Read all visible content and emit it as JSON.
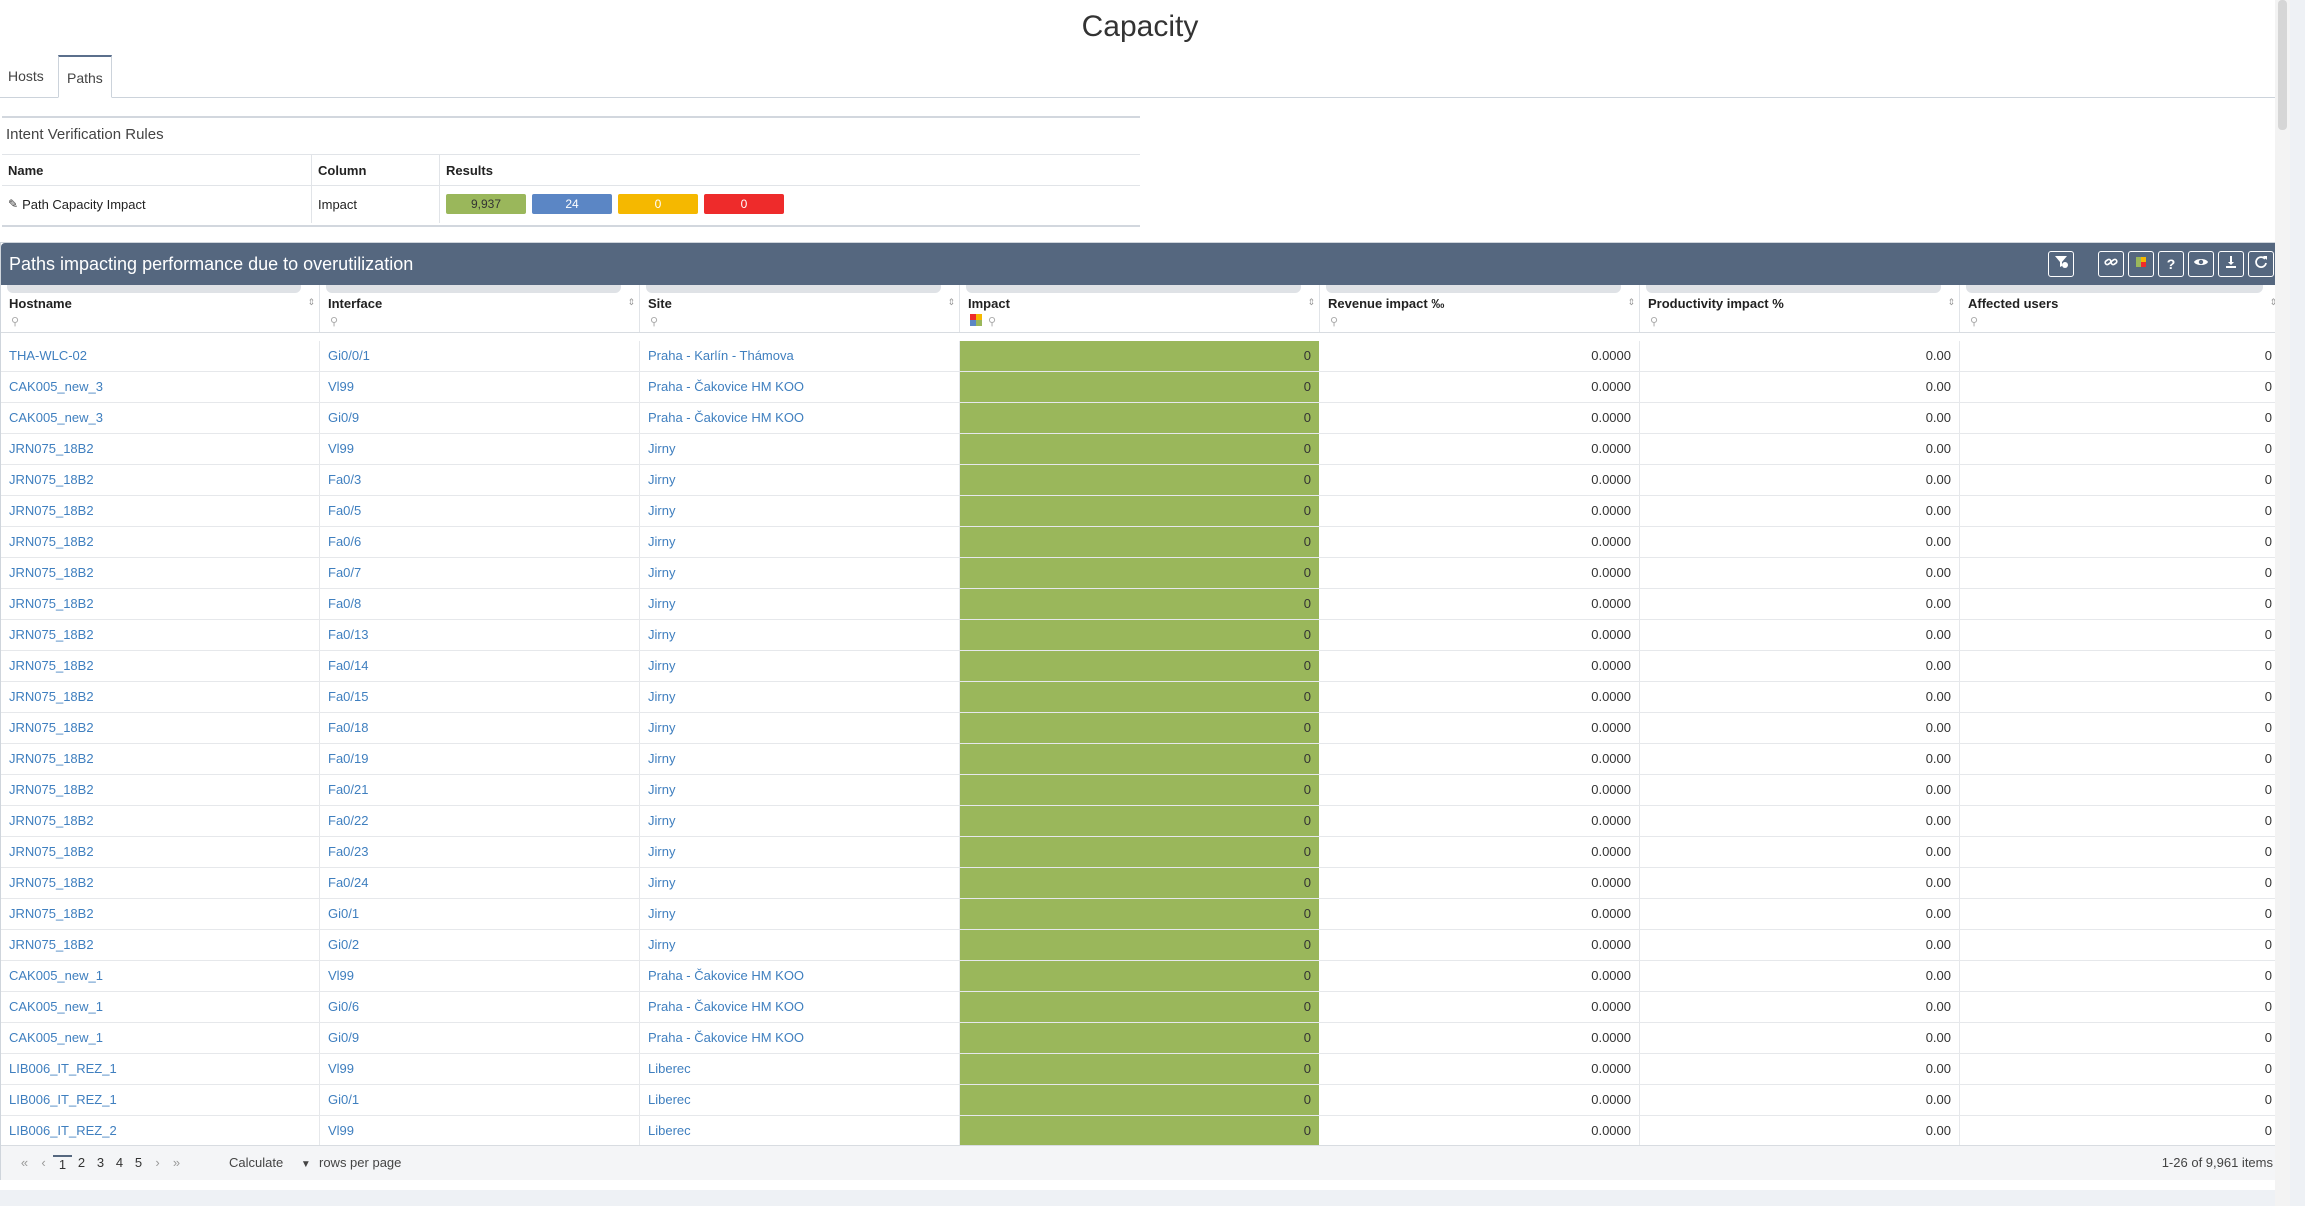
{
  "page_title": "Capacity",
  "tabs": [
    {
      "label": "Hosts",
      "active": false
    },
    {
      "label": "Paths",
      "active": true
    }
  ],
  "ivr": {
    "title": "Intent Verification Rules",
    "headers": {
      "name": "Name",
      "column": "Column",
      "results": "Results"
    },
    "row": {
      "name": "Path Capacity Impact",
      "column": "Impact",
      "results": [
        {
          "value": "9,937",
          "color": "#9ab75b",
          "text_color": "#333333"
        },
        {
          "value": "24",
          "color": "#5b86c5",
          "text_color": "#ffffff"
        },
        {
          "value": "0",
          "color": "#f5b800",
          "text_color": "#ffffff"
        },
        {
          "value": "0",
          "color": "#ee2b2b",
          "text_color": "#ffffff"
        }
      ]
    }
  },
  "grid": {
    "title": "Paths impacting performance due to overutilization",
    "toolbar_icons": [
      "filter-clear-icon",
      "link-icon",
      "color-legend-icon",
      "help-icon",
      "eye-icon",
      "download-icon",
      "refresh-icon"
    ],
    "columns": [
      "Hostname",
      "Interface",
      "Site",
      "Impact",
      "Revenue impact ‰",
      "Productivity impact %",
      "Affected users"
    ],
    "rows": [
      [
        "THA-WLC-02",
        "Gi0/0/1",
        "Praha - Karlín - Thámova",
        "0",
        "0.0000",
        "0.00",
        "0"
      ],
      [
        "CAK005_new_3",
        "Vl99",
        "Praha - Čakovice HM KOO",
        "0",
        "0.0000",
        "0.00",
        "0"
      ],
      [
        "CAK005_new_3",
        "Gi0/9",
        "Praha - Čakovice HM KOO",
        "0",
        "0.0000",
        "0.00",
        "0"
      ],
      [
        "JRN075_18B2",
        "Vl99",
        "Jirny",
        "0",
        "0.0000",
        "0.00",
        "0"
      ],
      [
        "JRN075_18B2",
        "Fa0/3",
        "Jirny",
        "0",
        "0.0000",
        "0.00",
        "0"
      ],
      [
        "JRN075_18B2",
        "Fa0/5",
        "Jirny",
        "0",
        "0.0000",
        "0.00",
        "0"
      ],
      [
        "JRN075_18B2",
        "Fa0/6",
        "Jirny",
        "0",
        "0.0000",
        "0.00",
        "0"
      ],
      [
        "JRN075_18B2",
        "Fa0/7",
        "Jirny",
        "0",
        "0.0000",
        "0.00",
        "0"
      ],
      [
        "JRN075_18B2",
        "Fa0/8",
        "Jirny",
        "0",
        "0.0000",
        "0.00",
        "0"
      ],
      [
        "JRN075_18B2",
        "Fa0/13",
        "Jirny",
        "0",
        "0.0000",
        "0.00",
        "0"
      ],
      [
        "JRN075_18B2",
        "Fa0/14",
        "Jirny",
        "0",
        "0.0000",
        "0.00",
        "0"
      ],
      [
        "JRN075_18B2",
        "Fa0/15",
        "Jirny",
        "0",
        "0.0000",
        "0.00",
        "0"
      ],
      [
        "JRN075_18B2",
        "Fa0/18",
        "Jirny",
        "0",
        "0.0000",
        "0.00",
        "0"
      ],
      [
        "JRN075_18B2",
        "Fa0/19",
        "Jirny",
        "0",
        "0.0000",
        "0.00",
        "0"
      ],
      [
        "JRN075_18B2",
        "Fa0/21",
        "Jirny",
        "0",
        "0.0000",
        "0.00",
        "0"
      ],
      [
        "JRN075_18B2",
        "Fa0/22",
        "Jirny",
        "0",
        "0.0000",
        "0.00",
        "0"
      ],
      [
        "JRN075_18B2",
        "Fa0/23",
        "Jirny",
        "0",
        "0.0000",
        "0.00",
        "0"
      ],
      [
        "JRN075_18B2",
        "Fa0/24",
        "Jirny",
        "0",
        "0.0000",
        "0.00",
        "0"
      ],
      [
        "JRN075_18B2",
        "Gi0/1",
        "Jirny",
        "0",
        "0.0000",
        "0.00",
        "0"
      ],
      [
        "JRN075_18B2",
        "Gi0/2",
        "Jirny",
        "0",
        "0.0000",
        "0.00",
        "0"
      ],
      [
        "CAK005_new_1",
        "Vl99",
        "Praha - Čakovice HM KOO",
        "0",
        "0.0000",
        "0.00",
        "0"
      ],
      [
        "CAK005_new_1",
        "Gi0/6",
        "Praha - Čakovice HM KOO",
        "0",
        "0.0000",
        "0.00",
        "0"
      ],
      [
        "CAK005_new_1",
        "Gi0/9",
        "Praha - Čakovice HM KOO",
        "0",
        "0.0000",
        "0.00",
        "0"
      ],
      [
        "LIB006_IT_REZ_1",
        "Vl99",
        "Liberec",
        "0",
        "0.0000",
        "0.00",
        "0"
      ],
      [
        "LIB006_IT_REZ_1",
        "Gi0/1",
        "Liberec",
        "0",
        "0.0000",
        "0.00",
        "0"
      ],
      [
        "LIB006_IT_REZ_2",
        "Vl99",
        "Liberec",
        "0",
        "0.0000",
        "0.00",
        "0"
      ]
    ],
    "impact_color": "#9ab75b",
    "header_color": "#55677f",
    "link_color": "#3f7fbf"
  },
  "pager": {
    "first": "«",
    "prev": "‹",
    "next": "›",
    "last": "»",
    "pages": [
      "1",
      "2",
      "3",
      "4",
      "5"
    ],
    "current_page": "1",
    "rows_select": "Calculate",
    "rows_label": "rows per page",
    "items_info": "1-26 of 9,961 items"
  }
}
